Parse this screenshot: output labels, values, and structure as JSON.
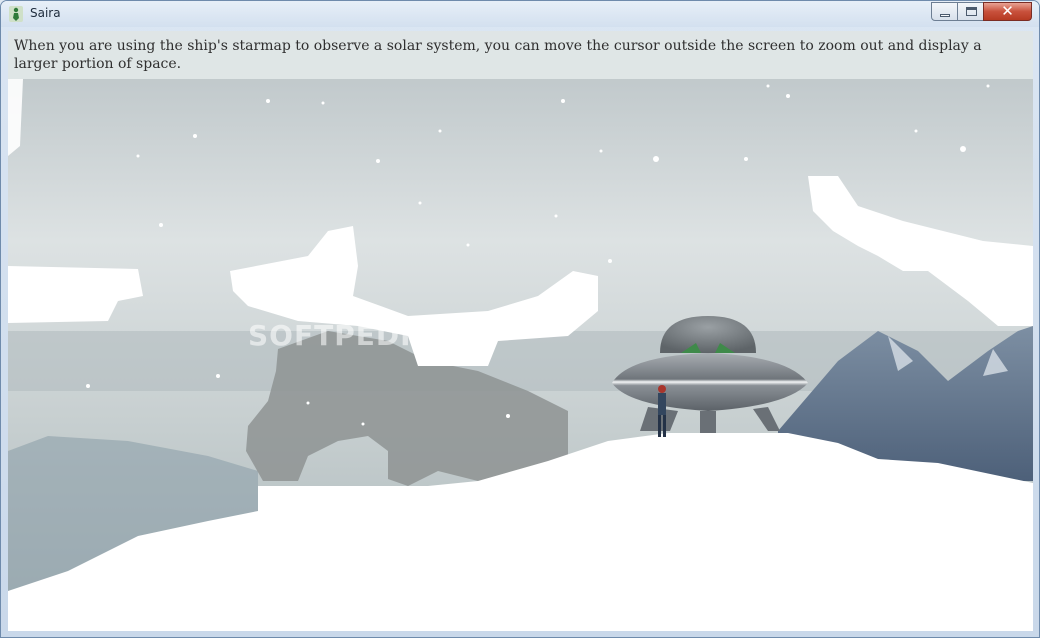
{
  "window": {
    "title": "Saira",
    "close_glyph": "✕"
  },
  "game": {
    "hint_text": "When you are using the ship's starmap to observe a solar system, you can move the cursor outside the screen to zoom out and display a larger portion of space.",
    "watermark": "SOFTPEDIA"
  },
  "colors": {
    "sky": "#c9d1d2",
    "snow": "#ffffff",
    "rock": "#8e9393",
    "mountain": "#5a6f86",
    "ship_hull": "#8c9298",
    "ship_dome": "#6f7579",
    "close_button": "#c8513c"
  },
  "icons": {
    "app": "saira-figure-icon",
    "minimize": "minimize-icon",
    "maximize": "maximize-icon",
    "close": "close-icon"
  }
}
